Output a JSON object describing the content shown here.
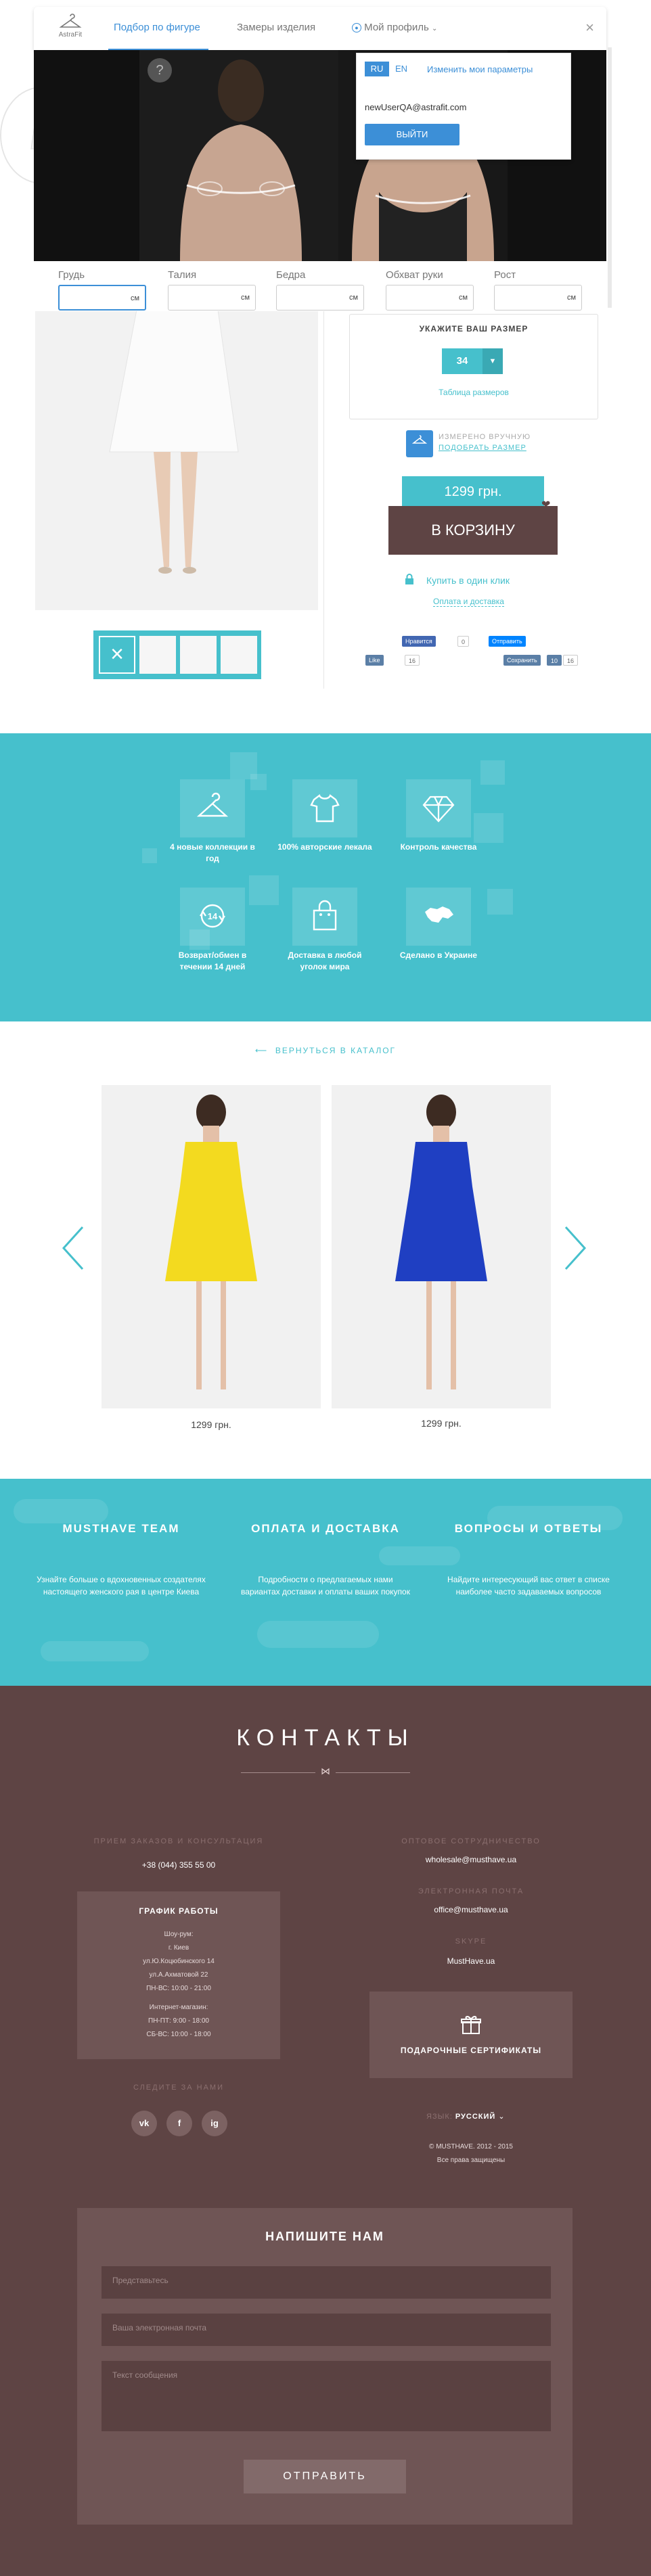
{
  "widget": {
    "logo_text": "AstraFit",
    "tabs": [
      "Подбор по фигуре",
      "Замеры изделия",
      "Мой профиль"
    ],
    "close": "×",
    "help": "?",
    "fields": [
      {
        "label": "Грудь",
        "unit": "см"
      },
      {
        "label": "Талия",
        "unit": "см"
      },
      {
        "label": "Бедра",
        "unit": "см"
      },
      {
        "label": "Обхват руки",
        "unit": "см"
      },
      {
        "label": "Рост",
        "unit": "см"
      }
    ],
    "profile": {
      "lang_ru": "RU",
      "lang_en": "EN",
      "change_params": "Изменить мои параметры",
      "email": "newUserQA@astrafit.com",
      "logout": "ВЫЙТИ"
    }
  },
  "product": {
    "size_title": "УКАЖИТЕ ВАШ РАЗМЕР",
    "size_value": "34",
    "size_table": "Таблица размеров",
    "astrafit_line1": "ИЗМЕРЕНО ВРУЧНУЮ",
    "astrafit_line2": "ПОДОБРАТЬ РАЗМЕР",
    "price": "1299 грн.",
    "cart": "В КОРЗИНУ",
    "one_click": "Купить в один клик",
    "payment": "Оплата и доставка",
    "fb_like": "Нравится",
    "fb_count": "0",
    "send": "Отправить",
    "vk_like": "Like",
    "vk_count": "16",
    "save": "Сохранить",
    "save_count": "10"
  },
  "features": [
    {
      "text": "4 новые коллекции в год",
      "icon": "hanger-icon"
    },
    {
      "text": "100% авторские лекала",
      "icon": "shirt-icon"
    },
    {
      "text": "Контроль качества",
      "icon": "diamond-icon"
    },
    {
      "text": "Возврат/обмен в течении 14 дней",
      "icon": "return-14-icon"
    },
    {
      "text": "Доставка в любой уголок мира",
      "icon": "bag-icon"
    },
    {
      "text": "Сделано в Украине",
      "icon": "ukraine-map-icon"
    }
  ],
  "related": {
    "back": "ВЕРНУТЬСЯ В КАТАЛОГ",
    "items": [
      {
        "price": "1299 грн.",
        "color": "#f3da1f"
      },
      {
        "price": "1299 грн.",
        "color": "#1f3fc2"
      }
    ]
  },
  "info": [
    {
      "title": "MUSTHAVE TEAM",
      "text": "Узнайте больше о вдохновенных создателях настоящего женского рая в центре Киева"
    },
    {
      "title": "ОПЛАТА И ДОСТАВКА",
      "text": "Подробности о предлагаемых нами вариантах доставки и оплаты ваших покупок"
    },
    {
      "title": "ВОПРОСЫ И ОТВЕТЫ",
      "text": "Найдите интересующий вас ответ в списке наиболее часто задаваемых вопросов"
    }
  ],
  "contacts": {
    "title": "КОНТАКТЫ",
    "orders_label": "ПРИЕМ ЗАКАЗОВ И КОНСУЛЬТАЦИЯ",
    "phone": "+38 (044) 355 55 00",
    "schedule_title": "ГРАФИК РАБОТЫ",
    "schedule_lines": [
      "Шоу-рум:",
      "г. Киев",
      "ул.Ю.Коцюбинского 14",
      "ул.А.Ахматовой 22",
      "ПН-ВС: 10:00 - 21:00",
      "",
      "Интернет-магазин:",
      "ПН-ПТ: 9:00 - 18:00",
      "СБ-ВС: 10:00 - 18:00"
    ],
    "follow_label": "СЛЕДИТЕ ЗА НАМИ",
    "socials": [
      "vk",
      "f",
      "ig"
    ],
    "wholesale_label": "ОПТОВОЕ СОТРУДНИЧЕСТВО",
    "wholesale": "wholesale@musthave.ua",
    "email_label": "ЭЛЕКТРОННАЯ ПОЧТА",
    "email": "office@musthave.ua",
    "skype_label": "SKYPE",
    "skype": "MustHave.ua",
    "gift": "ПОДАРОЧНЫЕ СЕРТИФИКАТЫ",
    "lang_label": "ЯЗЫК:",
    "lang_value": "РУССКИЙ",
    "copyright": "© MUSTHAVE. 2012 - 2015",
    "rights": "Все права защищены"
  },
  "form": {
    "title": "НАПИШИТЕ НАМ",
    "name": "Представьтесь",
    "email": "Ваша электронная почта",
    "message": "Текст сообщения",
    "send": "ОТПРАВИТЬ"
  },
  "colors": {
    "teal": "#46c0cc",
    "brown": "#5e4444",
    "widget_blue": "#3c8fd7"
  }
}
